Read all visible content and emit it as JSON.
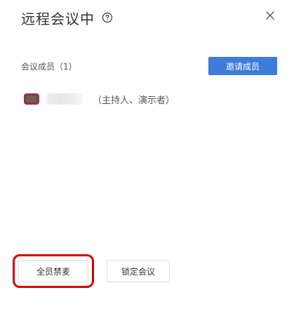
{
  "header": {
    "title": "远程会议中",
    "help_icon": "help-circle-icon",
    "close_icon": "close-icon"
  },
  "members": {
    "label": "会议成员（1）",
    "invite_label": "邀请成员",
    "accent_color": "#3f7bd8",
    "items": [
      {
        "avatar_icon": "avatar",
        "role": "（主持人、演示者）"
      }
    ]
  },
  "footer": {
    "mute_all_label": "全员禁麦",
    "lock_meeting_label": "锁定会议",
    "highlight_color": "#d40000"
  }
}
